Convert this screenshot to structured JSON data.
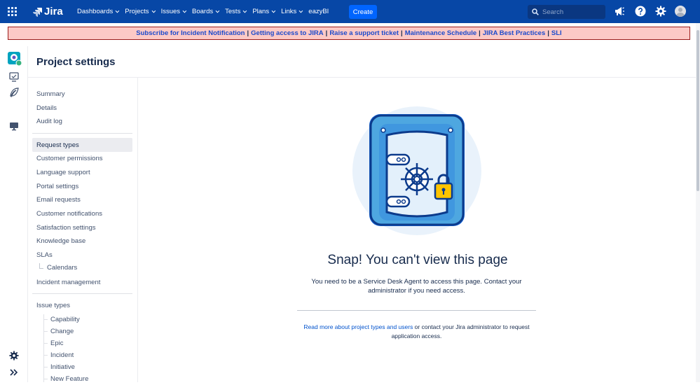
{
  "topnav": {
    "logo_text": "Jira",
    "items": [
      {
        "label": "Dashboards",
        "dropdown": true
      },
      {
        "label": "Projects",
        "dropdown": true
      },
      {
        "label": "Issues",
        "dropdown": true
      },
      {
        "label": "Boards",
        "dropdown": true
      },
      {
        "label": "Tests",
        "dropdown": true
      },
      {
        "label": "Plans",
        "dropdown": true
      },
      {
        "label": "Links",
        "dropdown": true
      },
      {
        "label": "eazyBI",
        "dropdown": false
      }
    ],
    "create_label": "Create",
    "search_placeholder": "Search",
    "colors": {
      "nav_bg": "#0747a6",
      "create_bg": "#0065ff"
    }
  },
  "banner": {
    "links": [
      "Subscribe for Incident Notification",
      "Getting access to JIRA",
      "Raise a support ticket",
      "Maintenance Schedule",
      "JIRA Best Practices",
      "SLI"
    ],
    "separator": "|",
    "colors": {
      "bg": "#fcc9c6",
      "border": "#9b1c1c",
      "link": "#1b4acc"
    }
  },
  "project": {
    "title": "Project settings"
  },
  "sidebar": {
    "group1": [
      "Summary",
      "Details",
      "Audit log"
    ],
    "group2": [
      "Request types",
      "Customer permissions",
      "Language support",
      "Portal settings",
      "Email requests",
      "Customer notifications",
      "Satisfaction settings",
      "Knowledge base",
      "SLAs"
    ],
    "slas_child": "Calendars",
    "incident": "Incident management",
    "active": "Request types",
    "issue_types_label": "Issue types",
    "issue_types": [
      "Capability",
      "Change",
      "Epic",
      "Incident",
      "Initiative",
      "New Feature"
    ]
  },
  "error": {
    "title": "Snap! You can't view this page",
    "message": "You need to be a Service Desk Agent to access this page. Contact your administrator if you need access.",
    "link_text": "Read more about project types and users",
    "footer_rest": " or contact your Jira administrator to request application access."
  }
}
